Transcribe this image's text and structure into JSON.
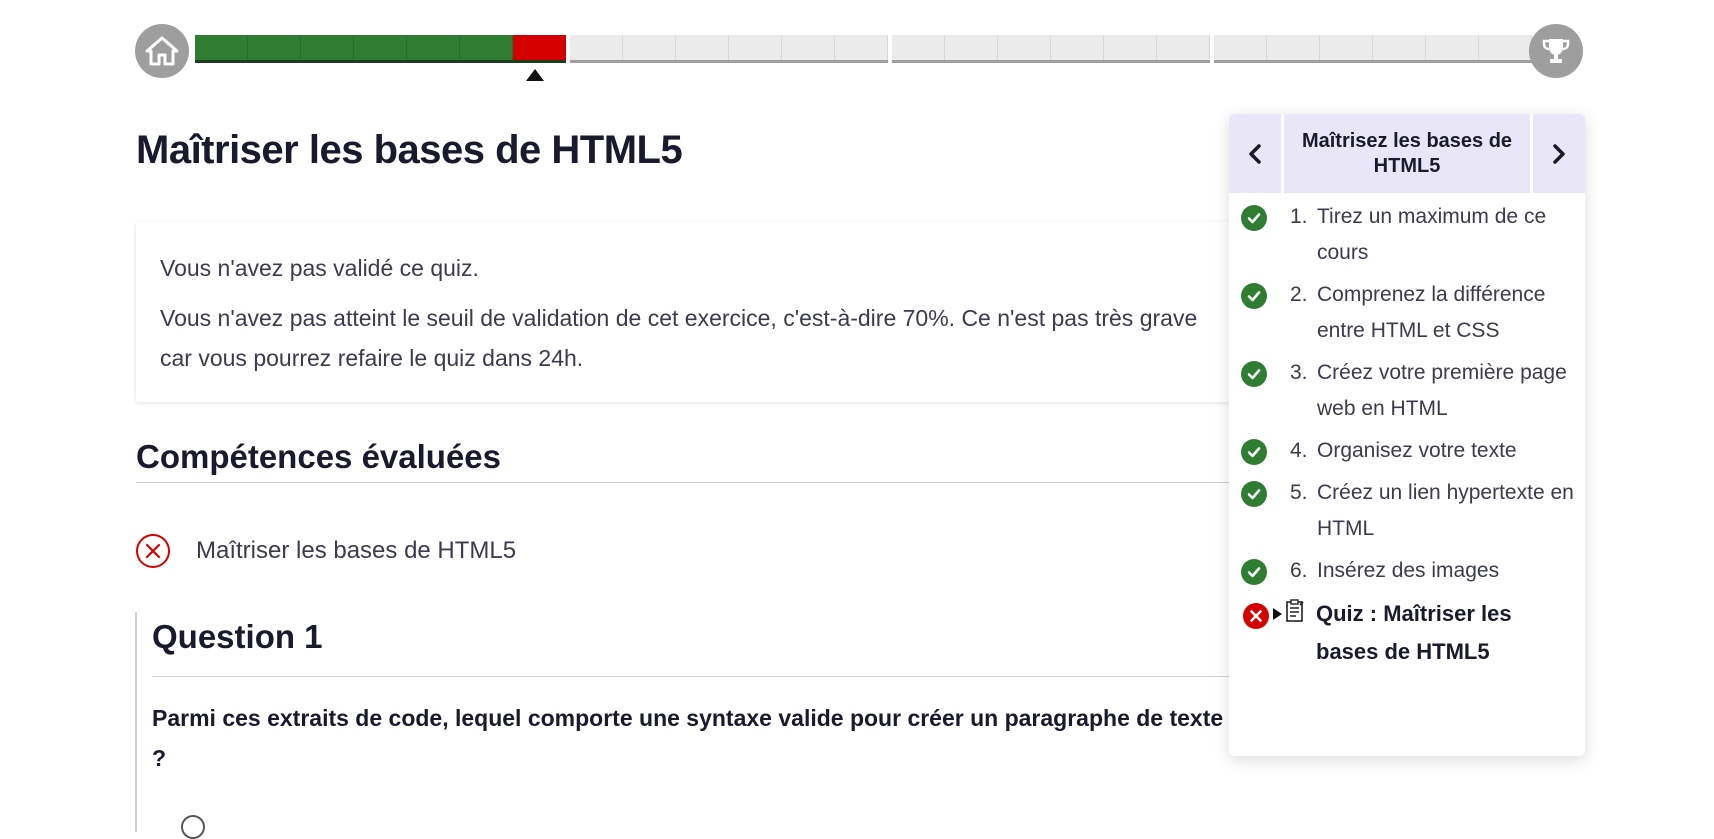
{
  "progress": {
    "done_segments": 6,
    "failed_segments": 1,
    "groups": [
      7,
      6,
      6,
      6
    ],
    "colors": {
      "done": "#2e7d32",
      "failed": "#d50000",
      "todo": "#ebebeb"
    },
    "home_icon": "home-icon",
    "trophy_icon": "trophy-icon"
  },
  "main": {
    "title": "Maîtriser les bases de HTML5",
    "result": {
      "line1": "Vous n'avez pas validé ce quiz.",
      "line2": "Vous n'avez pas atteint le seuil de validation de cet exercice, c'est-à-dire 70%. Ce n'est pas très grave car vous pourrez refaire le quiz dans 24h."
    },
    "skills_title": "Compétences évaluées",
    "skills": [
      {
        "label": "Maîtriser les bases de HTML5",
        "status": "failed"
      }
    ],
    "question": {
      "title": "Question 1",
      "text": "Parmi ces extraits de code, lequel comporte une syntaxe valide pour créer un paragraphe de texte ?"
    }
  },
  "sidebar": {
    "title": "Maîtrisez les bases de HTML5",
    "prev_icon": "chevron-left-icon",
    "next_icon": "chevron-right-icon",
    "chapters": [
      {
        "num": "1.",
        "label": "Tirez un maximum de ce cours",
        "status": "done"
      },
      {
        "num": "2.",
        "label": "Comprenez la différence entre HTML et CSS",
        "status": "done"
      },
      {
        "num": "3.",
        "label": "Créez votre première page web en HTML",
        "status": "done"
      },
      {
        "num": "4.",
        "label": "Organisez votre texte",
        "status": "done"
      },
      {
        "num": "5.",
        "label": "Créez un lien hypertexte en HTML",
        "status": "done"
      },
      {
        "num": "6.",
        "label": "Insérez des images",
        "status": "done"
      }
    ],
    "current": {
      "label": "Quiz : Maîtriser les bases de HTML5",
      "status": "failed"
    }
  }
}
